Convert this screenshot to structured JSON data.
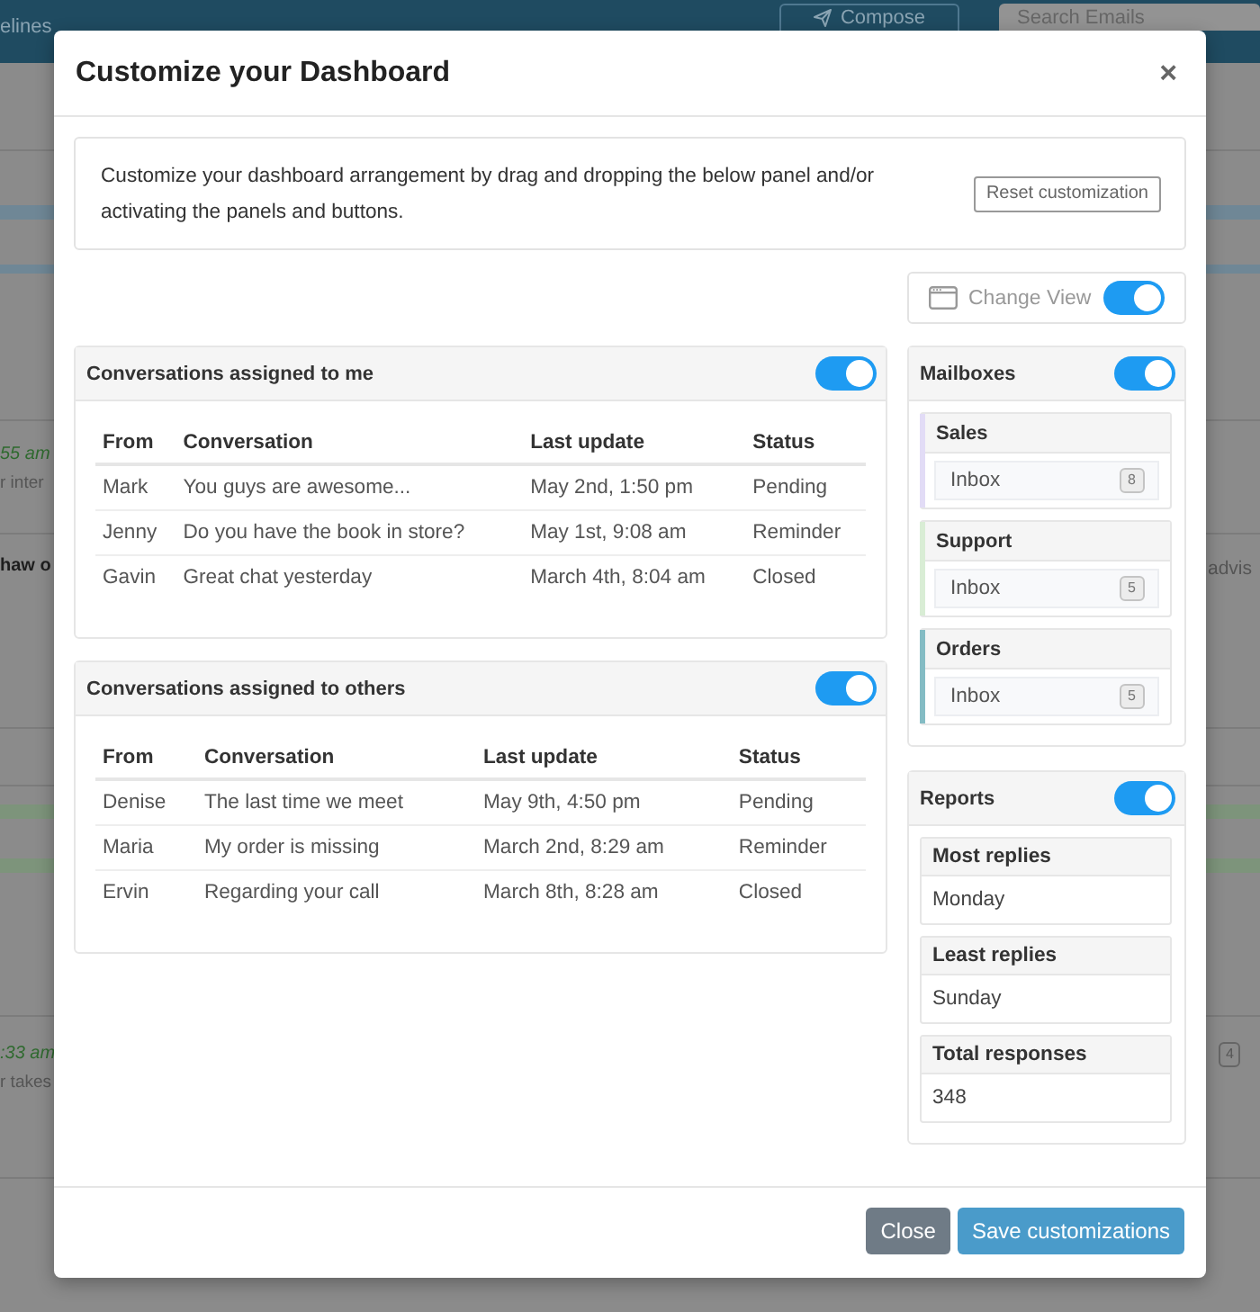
{
  "background": {
    "top_bar": {
      "nav_link": "elines",
      "compose_button": "Compose",
      "search_field": {
        "placeholder": "Search Emails"
      }
    },
    "list_rows": [
      {
        "time": "55 am",
        "snippet": "r inter"
      },
      {
        "sender": "haw o",
        "preview": "advis"
      },
      {
        "time": ":33 am",
        "snippet": "r takes",
        "count": "4"
      }
    ]
  },
  "modal": {
    "title": "Customize your Dashboard",
    "close_button": "×",
    "intro": {
      "text": "Customize your dashboard arrangement by drag and dropping the below panel and/or activating the panels and buttons.",
      "reset_button": "Reset customization"
    },
    "change_view": {
      "label": "Change View",
      "on": true
    },
    "conversation_panels": [
      {
        "title": "Conversations assigned to me",
        "on": true,
        "columns": [
          "From",
          "Conversation",
          "Last update",
          "Status"
        ],
        "rows": [
          [
            "Mark",
            "You guys are awesome...",
            "May 2nd, 1:50 pm",
            "Pending"
          ],
          [
            "Jenny",
            "Do you have the book in store?",
            "May 1st, 9:08 am",
            "Reminder"
          ],
          [
            "Gavin",
            "Great chat yesterday",
            "March 4th, 8:04 am",
            "Closed"
          ]
        ]
      },
      {
        "title": "Conversations assigned to others",
        "on": true,
        "columns": [
          "From",
          "Conversation",
          "Last update",
          "Status"
        ],
        "rows": [
          [
            "Denise",
            "The last time we meet",
            "May 9th, 4:50 pm",
            "Pending"
          ],
          [
            "Maria",
            "My order is missing",
            "March 2nd, 8:29 am",
            "Reminder"
          ],
          [
            "Ervin",
            "Regarding your call",
            "March 8th, 8:28 am",
            "Closed"
          ]
        ]
      }
    ],
    "mailboxes": {
      "title": "Mailboxes",
      "on": true,
      "groups": [
        {
          "name": "Sales",
          "color": "#e2dcf6",
          "folder": "Inbox",
          "count": "8"
        },
        {
          "name": "Support",
          "color": "#d9edd5",
          "folder": "Inbox",
          "count": "5"
        },
        {
          "name": "Orders",
          "color": "#84bcc4",
          "folder": "Inbox",
          "count": "5"
        }
      ]
    },
    "reports": {
      "title": "Reports",
      "on": true,
      "cards": [
        {
          "label": "Most replies",
          "value": "Monday"
        },
        {
          "label": "Least replies",
          "value": "Sunday"
        },
        {
          "label": "Total responses",
          "value": "348"
        }
      ]
    },
    "buttons": [
      {
        "label": "Close",
        "kind": "secondary"
      },
      {
        "label": "Save customizations",
        "kind": "primary"
      }
    ]
  }
}
